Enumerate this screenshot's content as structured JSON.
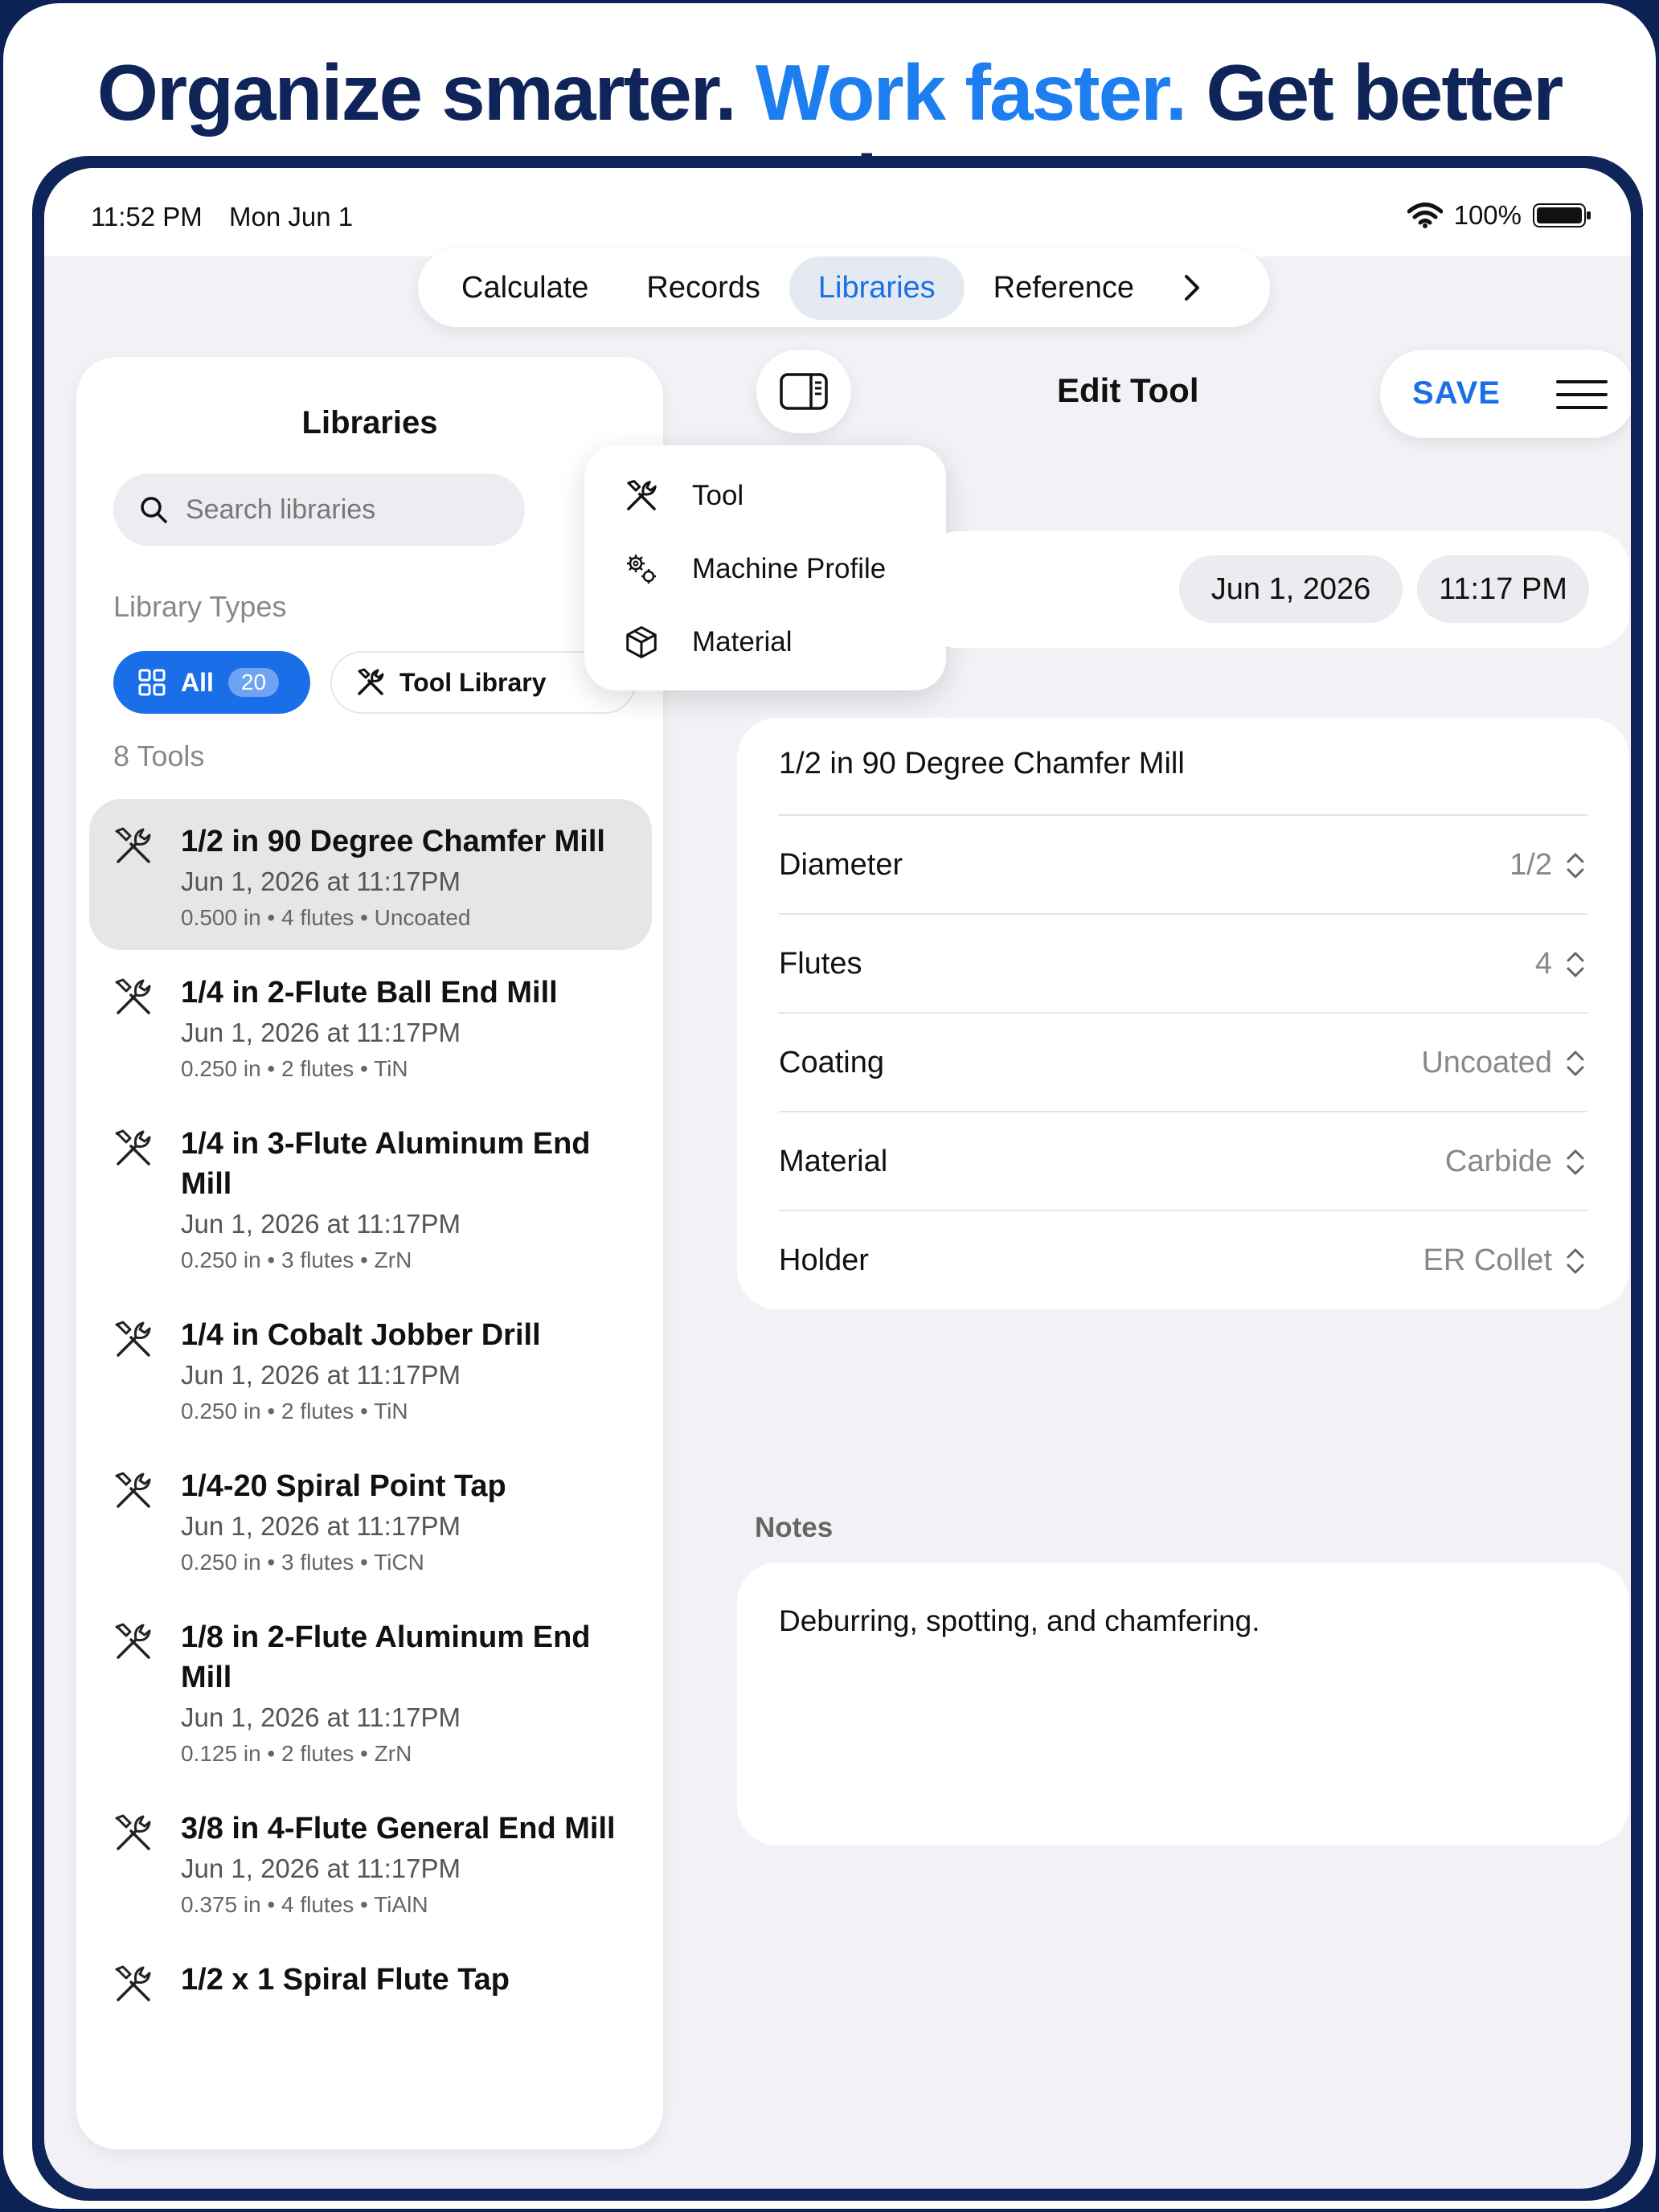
{
  "headline": {
    "part1": "Organize smarter.",
    "part2": "Work faster.",
    "part3": "Get better results."
  },
  "status": {
    "time": "11:52 PM",
    "date": "Mon Jun 1",
    "battery": "100%"
  },
  "tabs": [
    {
      "label": "Calculate"
    },
    {
      "label": "Records"
    },
    {
      "label": "Libraries"
    },
    {
      "label": "Reference"
    }
  ],
  "sidebar": {
    "title": "Libraries",
    "search_placeholder": "Search libraries",
    "library_types_label": "Library Types",
    "chip_all": {
      "label": "All",
      "count": "20"
    },
    "chip_tool": {
      "label": "Tool Library"
    },
    "tools_count_label": "8 Tools",
    "items": [
      {
        "title": "1/2 in 90 Degree Chamfer Mill",
        "date": "Jun 1, 2026 at 11:17PM",
        "meta": "0.500 in • 4 flutes • Uncoated"
      },
      {
        "title": "1/4 in 2-Flute Ball End Mill",
        "date": "Jun 1, 2026 at 11:17PM",
        "meta": "0.250 in • 2 flutes • TiN"
      },
      {
        "title": "1/4 in 3-Flute Aluminum End Mill",
        "date": "Jun 1, 2026 at 11:17PM",
        "meta": "0.250 in • 3 flutes • ZrN"
      },
      {
        "title": "1/4 in Cobalt Jobber Drill",
        "date": "Jun 1, 2026 at 11:17PM",
        "meta": "0.250 in • 2 flutes • TiN"
      },
      {
        "title": "1/4-20 Spiral Point Tap",
        "date": "Jun 1, 2026 at 11:17PM",
        "meta": "0.250 in • 3 flutes • TiCN"
      },
      {
        "title": "1/8 in 2-Flute Aluminum End Mill",
        "date": "Jun 1, 2026 at 11:17PM",
        "meta": "0.125 in • 2 flutes • ZrN"
      },
      {
        "title": "3/8 in 4-Flute General End Mill",
        "date": "Jun 1, 2026 at 11:17PM",
        "meta": "0.375 in • 4 flutes • TiAlN"
      },
      {
        "title": "1/2 x 1 Spiral Flute Tap",
        "date": "",
        "meta": ""
      }
    ]
  },
  "menu": {
    "items": [
      {
        "label": "Tool"
      },
      {
        "label": "Machine Profile"
      },
      {
        "label": "Material"
      }
    ]
  },
  "editor": {
    "title": "Edit Tool",
    "save_label": "SAVE",
    "date": "Jun 1, 2026",
    "time": "11:17 PM",
    "tool_name": "1/2 in 90 Degree Chamfer Mill",
    "fields": [
      {
        "label": "Diameter",
        "value": "1/2"
      },
      {
        "label": "Flutes",
        "value": "4"
      },
      {
        "label": "Coating",
        "value": "Uncoated"
      },
      {
        "label": "Material",
        "value": "Carbide"
      },
      {
        "label": "Holder",
        "value": "ER Collet"
      }
    ],
    "notes_label": "Notes",
    "notes": "Deburring, spotting, and chamfering."
  },
  "colors": {
    "accent": "#1a6fe8",
    "navy": "#0f2559",
    "headline_accent": "#1d7ef0"
  }
}
